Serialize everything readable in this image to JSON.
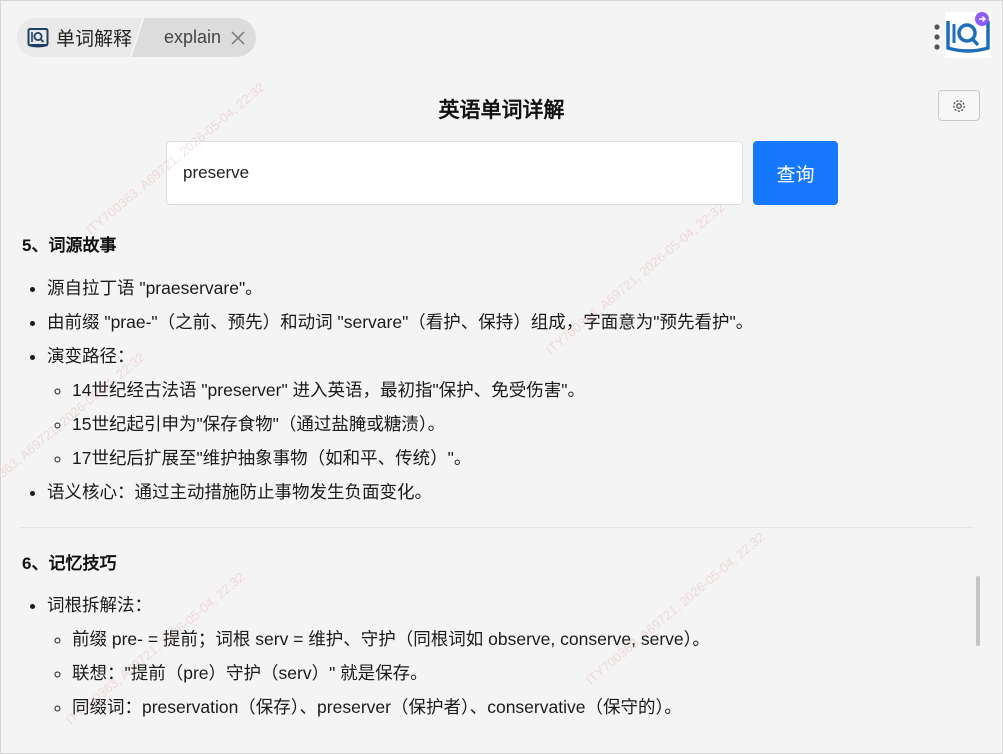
{
  "breadcrumb": {
    "app_label": "单词解释",
    "page_label": "explain"
  },
  "header": {
    "title": "英语单词详解"
  },
  "search": {
    "value": "preserve",
    "button_label": "查询"
  },
  "sections": [
    {
      "title": "5、词源故事",
      "items": [
        {
          "text": "源自拉丁语 \"praeservare\"。"
        },
        {
          "text": "由前缀 \"prae-\"（之前、预先）和动词 \"servare\"（看护、保持）组成，字面意为\"预先看护\"。"
        },
        {
          "text": "演变路径：",
          "children": [
            "14世纪经古法语 \"preserver\" 进入英语，最初指\"保护、免受伤害\"。",
            "15世纪起引申为\"保存食物\"（通过盐腌或糖渍）。",
            "17世纪后扩展至\"维护抽象事物（如和平、传统）\"。"
          ]
        },
        {
          "text": "语义核心：通过主动措施防止事物发生负面变化。"
        }
      ]
    },
    {
      "title": "6、记忆技巧",
      "items": [
        {
          "text": "词根拆解法：",
          "children": [
            "前缀 pre- = 提前；词根 serv = 维护、守护（同根词如 observe, conserve, serve）。",
            "联想：\"提前（pre）守护（serv）\" 就是保存。",
            "同缀词：preservation（保存）、preserver（保护者）、conservative（保守的）。"
          ]
        }
      ]
    }
  ],
  "watermark": {
    "text": "ITY700363, A69721, 2026-05-04, 22:32"
  },
  "colors": {
    "accent": "#1677ff",
    "logo": "#1f6fb8",
    "logo_badge": "#8b5cf6"
  },
  "icons": {
    "app": "dictionary-book-icon",
    "close": "close-icon",
    "more": "more-vertical-icon",
    "logo": "app-logo-icon",
    "settings": "gear-icon"
  }
}
